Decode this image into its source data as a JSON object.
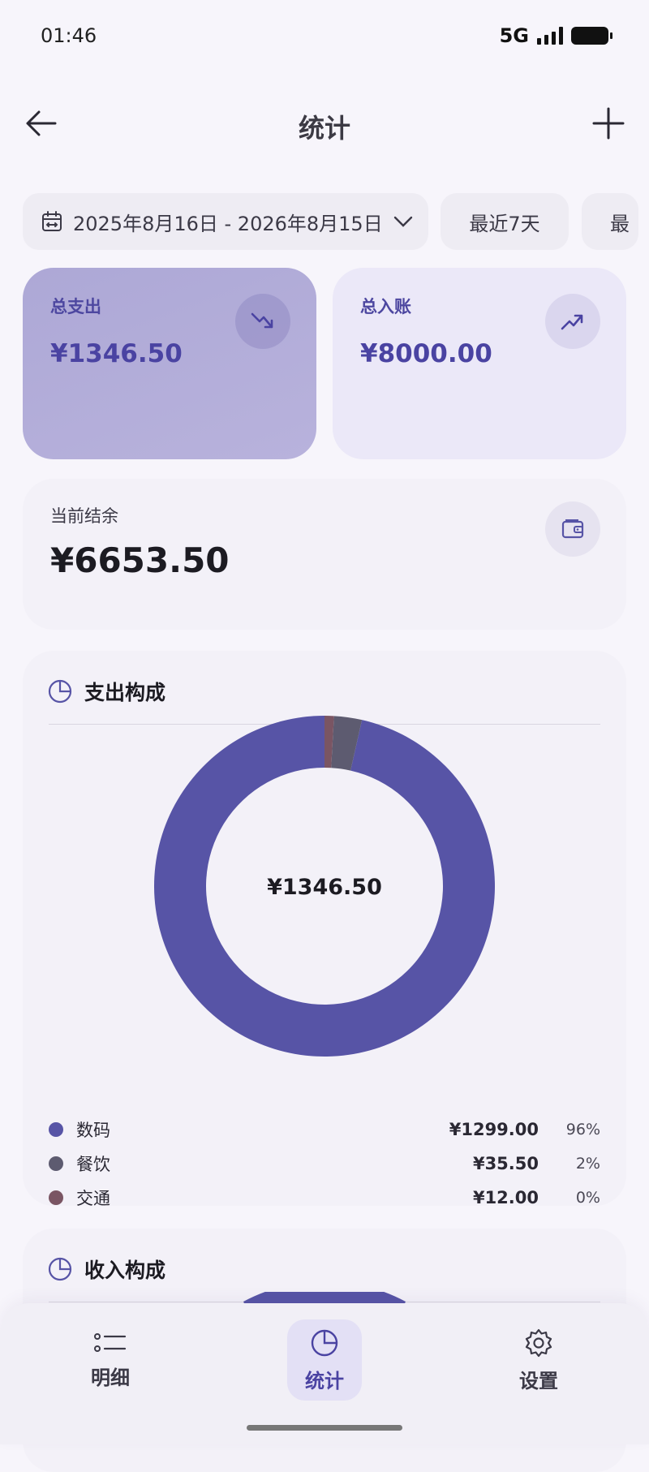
{
  "status_bar": {
    "time": "01:46",
    "network": "5G"
  },
  "header": {
    "title": "统计"
  },
  "date_range": {
    "label": "2025年8月16日 - 2026年8月15日",
    "chips": [
      "最近7天",
      "最"
    ]
  },
  "summary": {
    "expense": {
      "label": "总支出",
      "value": "¥1346.50"
    },
    "income": {
      "label": "总入账",
      "value": "¥8000.00"
    },
    "balance": {
      "label": "当前结余",
      "value": "¥6653.50"
    }
  },
  "expense_composition": {
    "title": "支出构成",
    "total": "¥1346.50",
    "items": [
      {
        "name": "数码",
        "amount": "¥1299.00",
        "percent": "96%",
        "value": 1299.0,
        "color": "#5754a6"
      },
      {
        "name": "餐饮",
        "amount": "¥35.50",
        "percent": "2%",
        "value": 35.5,
        "color": "#5d5b70"
      },
      {
        "name": "交通",
        "amount": "¥12.00",
        "percent": "0%",
        "value": 12.0,
        "color": "#7a5563"
      }
    ]
  },
  "income_composition": {
    "title": "收入构成"
  },
  "bottom_nav": {
    "items": [
      {
        "label": "明细",
        "icon": "list-icon"
      },
      {
        "label": "统计",
        "icon": "pie-chart-icon",
        "active": true
      },
      {
        "label": "设置",
        "icon": "gear-icon"
      }
    ]
  },
  "colors": {
    "accent": "#4a43a2",
    "primary_donut": "#5754a6"
  }
}
